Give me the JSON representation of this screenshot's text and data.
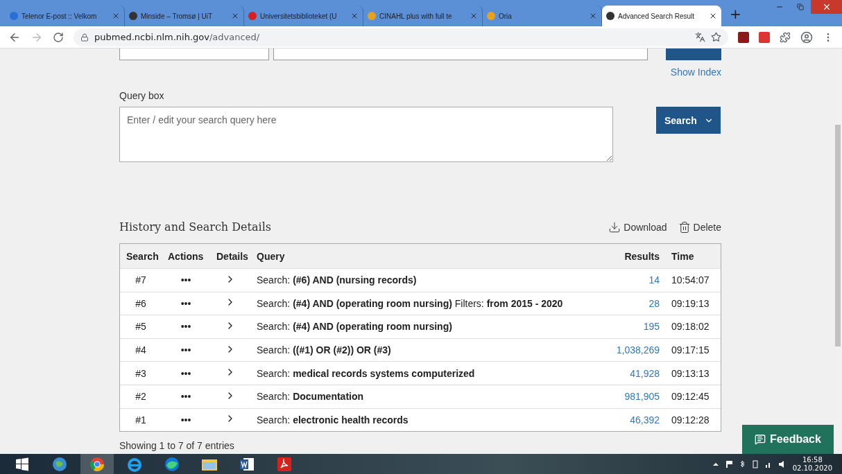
{
  "browser": {
    "tabs": [
      {
        "title": "Telenor E-post :: Velkom",
        "selected": false,
        "color": "#2a6fd6"
      },
      {
        "title": "Minside – Tromsø | UiT",
        "selected": false,
        "color": "#333333"
      },
      {
        "title": "Universitetsbiblioteket (U",
        "selected": false,
        "color": "#d42020"
      },
      {
        "title": "CINAHL plus with full te",
        "selected": false,
        "color": "#e8a020"
      },
      {
        "title": "Oria",
        "selected": false,
        "color": "#e8a020"
      },
      {
        "title": "Advanced Search Result",
        "selected": true,
        "color": "#333333"
      }
    ],
    "new_tab": "+",
    "url_host": "pubmed.ncbi.nlm.nih.gov",
    "url_path": "/advanced/"
  },
  "page": {
    "show_index": "Show Index",
    "query_label": "Query box",
    "query_placeholder": "Enter / edit your search query here",
    "search_button": "Search",
    "history_title": "History and Search Details",
    "download": "Download",
    "delete": "Delete",
    "columns": [
      "Search",
      "Actions",
      "Details",
      "Query",
      "Results",
      "Time"
    ],
    "rows": [
      {
        "search": "#7",
        "actions": "•••",
        "query": "Search: **(#6) AND (nursing records)**",
        "results": "14",
        "time": "10:54:07"
      },
      {
        "search": "#6",
        "actions": "•••",
        "query": "Search: **(#4) AND (operating room nursing)** Filters: **from 2015 - 2020**",
        "results": "28",
        "time": "09:19:13"
      },
      {
        "search": "#5",
        "actions": "•••",
        "query": "Search: **(#4) AND (operating room nursing)**",
        "results": "195",
        "time": "09:18:02"
      },
      {
        "search": "#4",
        "actions": "•••",
        "query": "Search: **((#1) OR (#2)) OR (#3)**",
        "results": "1,038,269",
        "time": "09:17:15"
      },
      {
        "search": "#3",
        "actions": "•••",
        "query": "Search: **medical records systems computerized**",
        "results": "41,928",
        "time": "09:13:13"
      },
      {
        "search": "#2",
        "actions": "•••",
        "query": "Search: **Documentation**",
        "results": "981,905",
        "time": "09:12:45"
      },
      {
        "search": "#1",
        "actions": "•••",
        "query": "Search: **electronic health records**",
        "results": "46,392",
        "time": "09:12:28"
      }
    ],
    "footer": "Showing 1 to 7 of 7 entries",
    "feedback": "Feedback"
  },
  "taskbar": {
    "time": "16:58",
    "date": "02.10.2020"
  }
}
